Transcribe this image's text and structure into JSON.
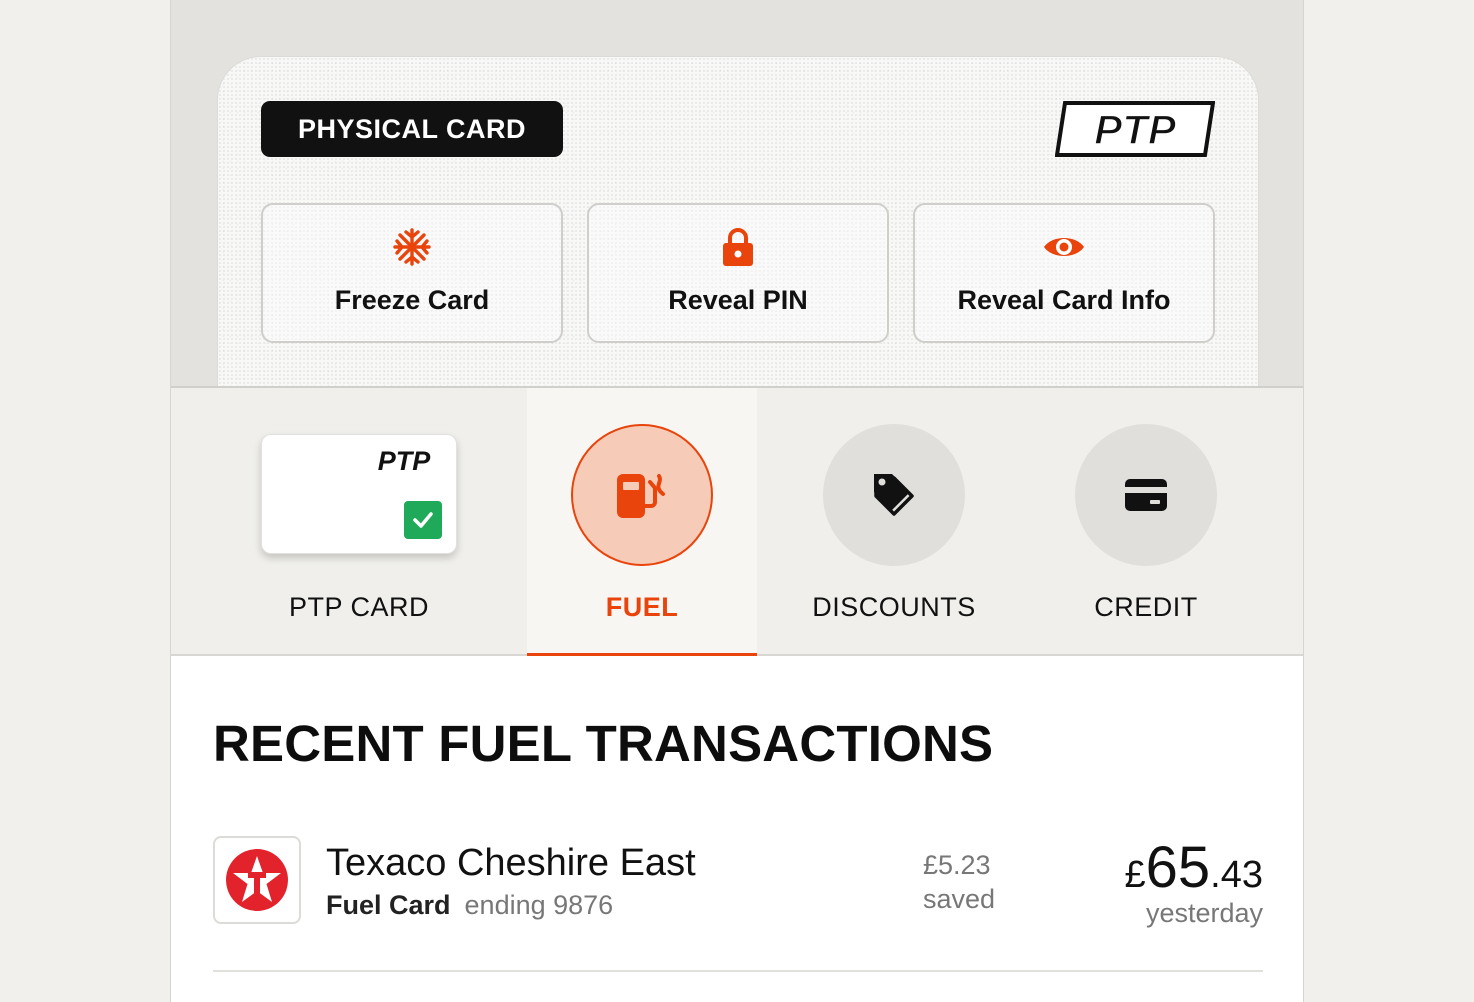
{
  "card": {
    "badge": "PHYSICAL CARD",
    "brand_logo": "PTP",
    "actions": [
      {
        "label": "Freeze Card",
        "icon": "snowflake-icon"
      },
      {
        "label": "Reveal PIN",
        "icon": "lock-icon"
      },
      {
        "label": "Reveal Card Info",
        "icon": "eye-icon"
      }
    ]
  },
  "tabs": [
    {
      "label": "PTP CARD",
      "icon": "card-thumbnail",
      "logo": "PTP"
    },
    {
      "label": "FUEL",
      "icon": "fuel-pump-icon",
      "active": true
    },
    {
      "label": "DISCOUNTS",
      "icon": "tag-icon"
    },
    {
      "label": "CREDIT",
      "icon": "credit-card-icon"
    }
  ],
  "section_title": "RECENT FUEL TRANSACTIONS",
  "transactions": [
    {
      "merchant": "Texaco Cheshire East",
      "card_type": "Fuel Card",
      "card_ending": "ending 9876",
      "saved_amount": "£5.23",
      "saved_label": "saved",
      "currency": "£",
      "amount_main": "65",
      "amount_decimal": ".43",
      "when": "yesterday"
    }
  ],
  "colors": {
    "accent": "#e8440c",
    "check_green": "#1faa5a",
    "texaco_red": "#e3232b"
  }
}
